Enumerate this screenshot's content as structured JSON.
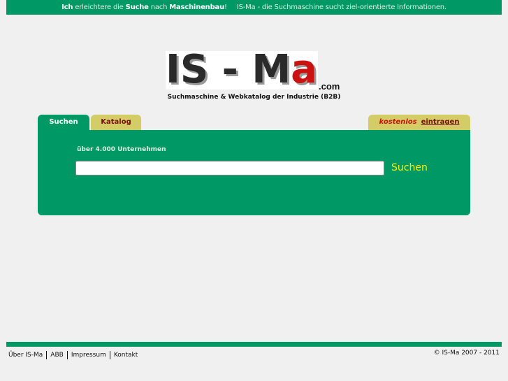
{
  "topbar": {
    "part1_bold": "Ich",
    "part2": " erleichtere die ",
    "part3_bold": "Suche",
    "part4": " nach ",
    "part5_bold": "Maschinenbau",
    "part6": "!",
    "part7": "IS-Ma - die Suchmaschine sucht ziel-orientierte Informationen."
  },
  "logo": {
    "text_a": "IS - M",
    "text_b": "a",
    "suffix": ".com",
    "tagline": "Suchmaschine & Webkatalog der Industrie (B2B)"
  },
  "tabs": {
    "search": "Suchen",
    "katalog": "Katalog",
    "register_free": "kostenlos",
    "register_link": "eintragen"
  },
  "search": {
    "count": "über 4.000 Unternehmen",
    "value": "",
    "button": "Suchen"
  },
  "footer": {
    "links": [
      "Über IS-Ma",
      "ABB",
      "Impressum",
      "Kontakt"
    ],
    "copyright": "© IS-Ma 2007 - 2011"
  },
  "colors": {
    "brand_green": "#009966",
    "tab_yellow": "#d4cc66",
    "accent_red": "#cc1111",
    "button_yellow": "#ffee00"
  }
}
